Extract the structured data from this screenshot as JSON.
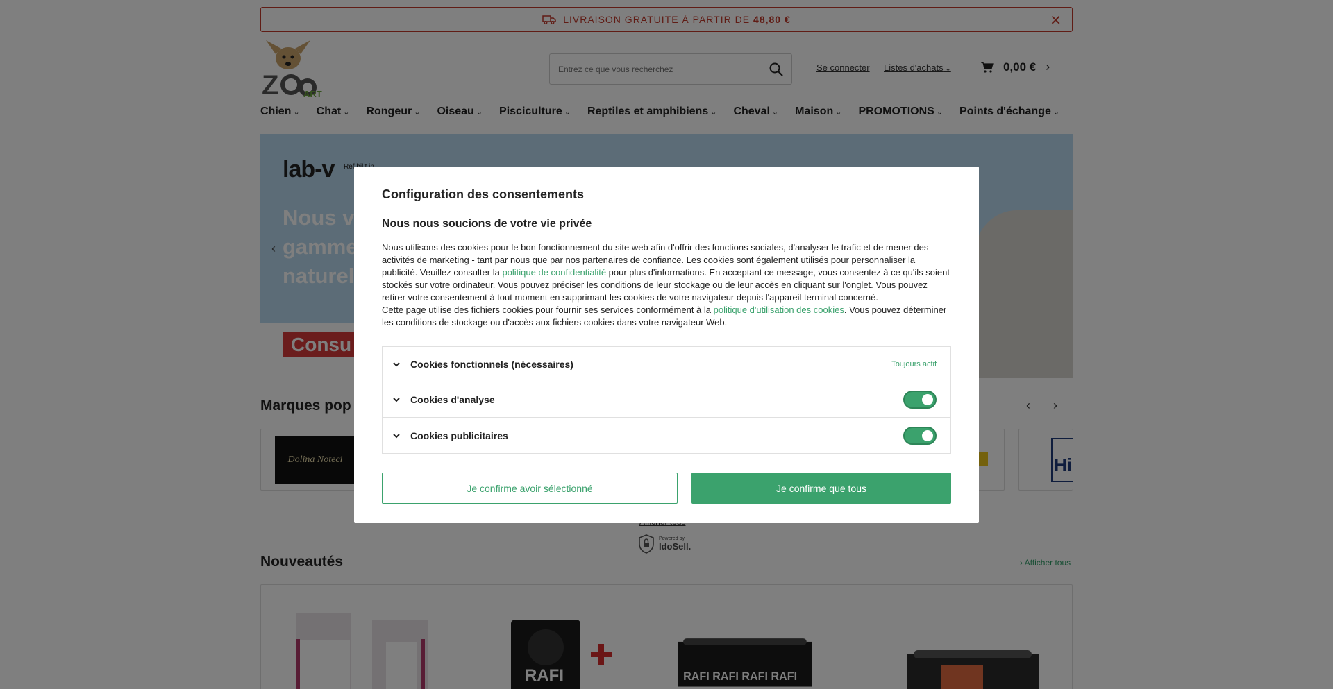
{
  "promo": {
    "text": "LIVRAISON GRATUITE À PARTIR DE",
    "amount": "48,80 €"
  },
  "search": {
    "placeholder": "Entrez ce que vous recherchez"
  },
  "header": {
    "login": "Se connecter",
    "lists": "Listes d'achats",
    "cart_total": "0,00 €"
  },
  "nav": [
    "Chien",
    "Chat",
    "Rongeur",
    "Oiseau",
    "Pisciculture",
    "Reptiles et amphibiens",
    "Cheval",
    "Maison",
    "PROMOTIONS",
    "Points d'échange"
  ],
  "hero": {
    "brand": "lab-v",
    "tag": "Ref bilit in",
    "title_lines": [
      "Nous v",
      "gamme",
      "naturel"
    ],
    "cta": "Consu"
  },
  "brands": {
    "title": "Marques pop",
    "logo1": "Dolina Noteci",
    "logo_last": "Hi"
  },
  "links": {
    "show_all": "Afficher tous",
    "powered_small": "Powered by",
    "powered_brand": "IdoSell."
  },
  "news": {
    "title": "Nouveautés",
    "show_all": "Afficher tous"
  },
  "modal": {
    "title": "Configuration des consentements",
    "subtitle": "Nous nous soucions de votre vie privée",
    "p1_a": "Nous utilisons des cookies pour le bon fonctionnement du site web afin d'offrir des fonctions sociales, d'analyser le trafic et de mener des activités de marketing - tant par nous que par nos partenaires de confiance. Les cookies sont également utilisés pour personnaliser la publicité. Veuillez consulter la ",
    "p1_link": "politique de confidentialité",
    "p1_b": " pour plus d'informations. En acceptant ce message, vous consentez à ce qu'ils soient stockés sur votre ordinateur. Vous pouvez préciser les conditions de leur stockage ou de leur accès en cliquant sur l'onglet. Vous pouvez retirer votre consentement à tout moment en supprimant les cookies de votre navigateur depuis l'appareil terminal concerné.",
    "p2_a": "Cette page utilise des fichiers cookies pour fournir ses services conformément à la ",
    "p2_link": "politique d'utilisation des cookies",
    "p2_b": ". Vous pouvez déterminer les conditions de stockage ou d'accès aux fichiers cookies dans votre navigateur Web.",
    "categories": [
      {
        "label": "Cookies fonctionnels (nécessaires)",
        "status": "Toujours actif"
      },
      {
        "label": "Cookies d'analyse",
        "enabled": true
      },
      {
        "label": "Cookies publicitaires",
        "enabled": true
      }
    ],
    "btn_selected": "Je confirme avoir sélectionné",
    "btn_all": "Je confirme que tous"
  },
  "colors": {
    "accent": "#3ba26d",
    "promo_red": "#c0392b"
  }
}
